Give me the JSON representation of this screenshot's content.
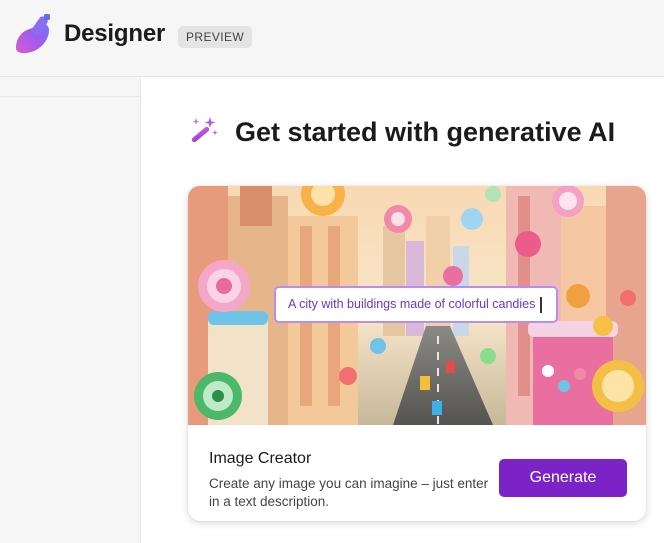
{
  "header": {
    "app_name": "Designer",
    "badge": "PREVIEW",
    "logo_icon": "designer-logo-icon"
  },
  "main": {
    "heading": "Get started with generative AI",
    "heading_icon": "magic-wand-sparkle-icon",
    "card": {
      "prompt_text": "A city with buildings made of colorful candies",
      "title": "Image Creator",
      "description": "Create any image you can imagine – just enter in a text description.",
      "button_label": "Generate"
    }
  },
  "colors": {
    "accent": "#7b23c6",
    "prompt_border": "#b58ef0",
    "header_bg": "#f6f6f6"
  }
}
